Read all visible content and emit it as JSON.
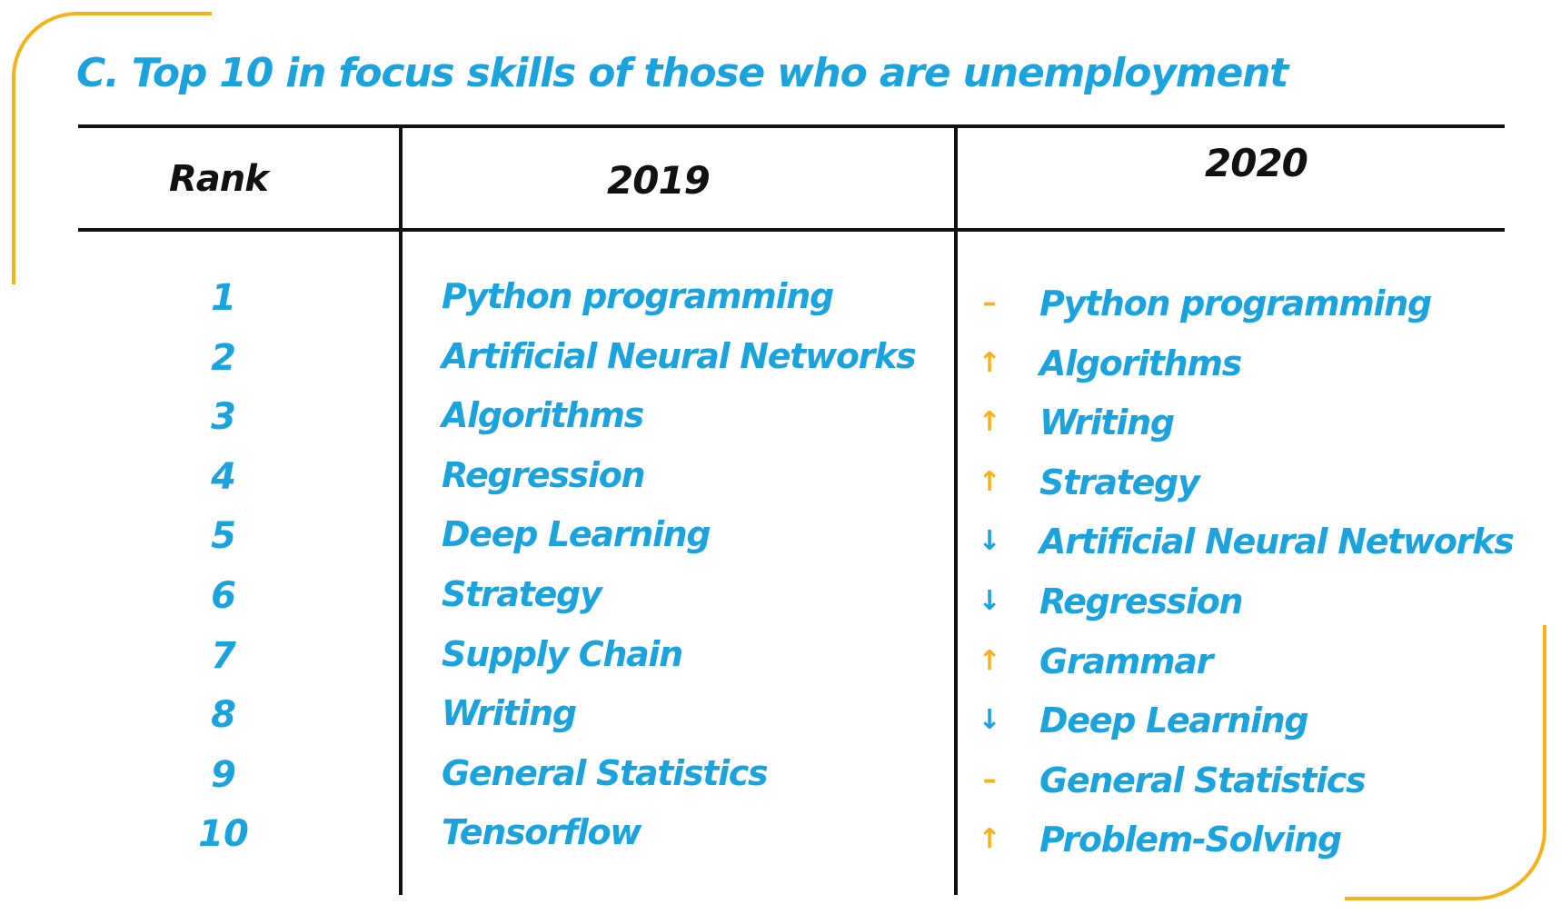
{
  "title": "C. Top 10 in focus skills of those who are unemployment",
  "headers": {
    "rank": "Rank",
    "col_2019": "2019",
    "col_2020": "2020"
  },
  "colors": {
    "accent_blue": "#1ba3dd",
    "accent_yellow": "#f6b21b",
    "text_dark": "#111111"
  },
  "ranks": [
    "1",
    "2",
    "3",
    "4",
    "5",
    "6",
    "7",
    "8",
    "9",
    "10"
  ],
  "skills_2019": [
    "Python programming",
    "Artificial Neural Networks",
    "Algorithms",
    "Regression",
    "Deep Learning",
    "Strategy",
    "Supply Chain",
    "Writing",
    "General Statistics",
    "Tensorflow"
  ],
  "skills_2020": [
    {
      "trend": "same",
      "icon": "–",
      "name": "Python programming"
    },
    {
      "trend": "up",
      "icon": "↑",
      "name": "Algorithms"
    },
    {
      "trend": "up",
      "icon": "↑",
      "name": "Writing"
    },
    {
      "trend": "up",
      "icon": "↑",
      "name": "Strategy"
    },
    {
      "trend": "down",
      "icon": "↓",
      "name": "Artificial Neural Networks"
    },
    {
      "trend": "down",
      "icon": "↓",
      "name": "Regression"
    },
    {
      "trend": "up",
      "icon": "↑",
      "name": "Grammar"
    },
    {
      "trend": "down",
      "icon": "↓",
      "name": "Deep Learning"
    },
    {
      "trend": "same",
      "icon": "–",
      "name": "General Statistics"
    },
    {
      "trend": "up",
      "icon": "↑",
      "name": "Problem-Solving"
    }
  ]
}
